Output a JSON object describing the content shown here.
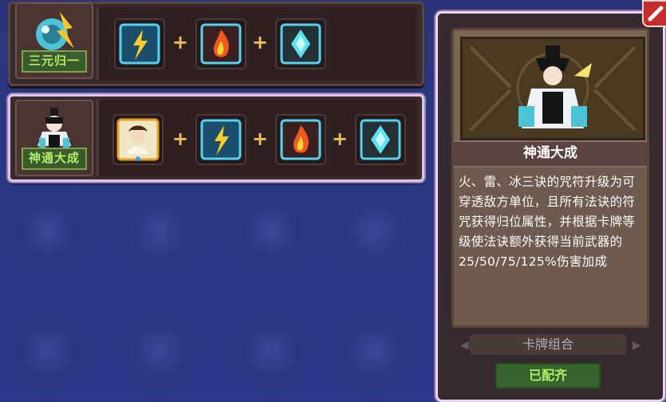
{
  "combos": [
    {
      "name": "三元归一",
      "cards": [
        "lightning-talisman",
        "fire-talisman",
        "ice-talisman"
      ]
    },
    {
      "name": "神通大成",
      "cards": [
        "spirit-girl-card",
        "lightning-talisman",
        "fire-talisman",
        "ice-talisman"
      ]
    }
  ],
  "detail": {
    "title": "神通大成",
    "description": "火、雷、冰三诀的咒符升级为可穿透敌方单位，且所有法诀的符咒获得归位属性，并根据卡牌等级使法诀额外获得当前武器的25/50/75/125%伤害加成",
    "section_label": "卡牌组合",
    "status": "已配齐"
  },
  "colors": {
    "accent_green": "#aef06a",
    "plus": "#f1c25a",
    "close": "#c62d2d"
  }
}
